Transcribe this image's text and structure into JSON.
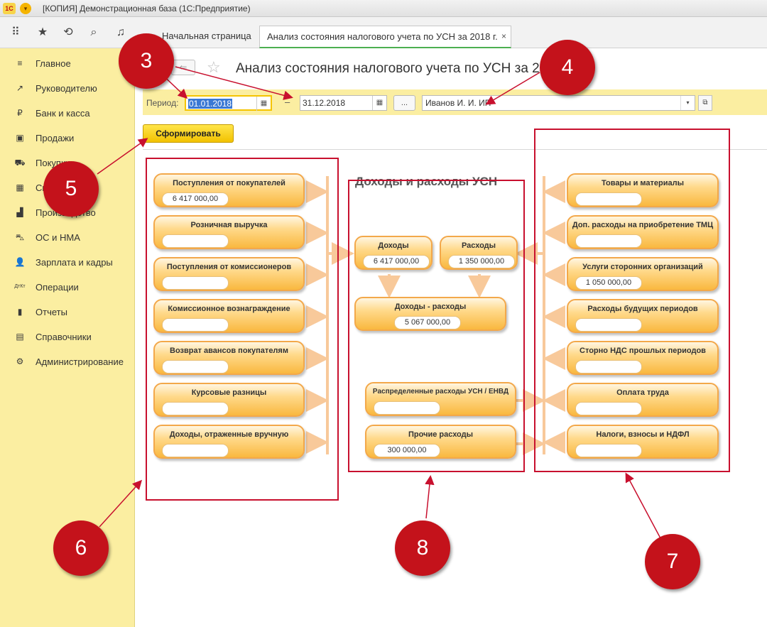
{
  "window": {
    "title": "[КОПИЯ] Демонстрационная база  (1С:Предприятие)",
    "logo": "1С",
    "menu_glyph": "▾"
  },
  "toolbar_icons": [
    {
      "name": "apps-grid-icon",
      "glyph": "⠿"
    },
    {
      "name": "star-icon",
      "glyph": "★"
    },
    {
      "name": "history-icon",
      "glyph": "⟲"
    },
    {
      "name": "search-icon",
      "glyph": "⌕"
    },
    {
      "name": "bell-icon",
      "glyph": "♫"
    }
  ],
  "sidebar": {
    "items": [
      {
        "icon": "≡",
        "label": "Главное"
      },
      {
        "icon": "↗",
        "label": "Руководителю"
      },
      {
        "icon": "₽",
        "label": "Банк и касса"
      },
      {
        "icon": "▣",
        "label": "Продажи"
      },
      {
        "icon": "⛟",
        "label": "Покупки"
      },
      {
        "icon": "▦",
        "label": "Склад"
      },
      {
        "icon": "▟",
        "label": "Производство"
      },
      {
        "icon": "⛍",
        "label": "ОС и НМА"
      },
      {
        "icon": "👤",
        "label": "Зарплата и кадры"
      },
      {
        "icon": "ДтКт",
        "label": "Операции"
      },
      {
        "icon": "▮",
        "label": "Отчеты"
      },
      {
        "icon": "▤",
        "label": "Справочники"
      },
      {
        "icon": "⚙",
        "label": "Администрирование"
      }
    ]
  },
  "tabs": {
    "home": "Начальная страница",
    "active": "Анализ состояния налогового учета по УСН за 2018 г.",
    "close": "×"
  },
  "form": {
    "back": "⇐",
    "star": "☆",
    "title": "Анализ состояния налогового учета по УСН за 2018 г.",
    "period_label": "Период:",
    "date_from": "01.01.2018",
    "dash": "–",
    "date_to": "31.12.2018",
    "cal_icon": "▦",
    "dots": "...",
    "organization": "Иванов И. И. ИП",
    "dropdown_icon": "▾",
    "open_icon": "⧉",
    "generate": "Сформировать"
  },
  "scheme": {
    "title": "Доходы и расходы УСН",
    "income_sources": [
      {
        "label": "Поступления от покупателей",
        "value": "6 417 000,00"
      },
      {
        "label": "Розничная выручка",
        "value": ""
      },
      {
        "label": "Поступления от комиссионеров",
        "value": ""
      },
      {
        "label": "Комиссионное вознаграждение",
        "value": ""
      },
      {
        "label": "Возврат авансов покупателям",
        "value": ""
      },
      {
        "label": "Курсовые разницы",
        "value": ""
      },
      {
        "label": "Доходы, отраженные вручную",
        "value": ""
      }
    ],
    "center": {
      "income": {
        "label": "Доходы",
        "value": "6 417 000,00"
      },
      "expenses": {
        "label": "Расходы",
        "value": "1 350 000,00"
      },
      "difference": {
        "label": "Доходы - расходы",
        "value": "5 067 000,00"
      },
      "distributed": {
        "label": "Распределенные расходы УСН / ЕНВД",
        "value": ""
      },
      "other": {
        "label": "Прочие расходы",
        "value": "300 000,00"
      }
    },
    "expense_sources": [
      {
        "label": "Товары и материалы",
        "value": ""
      },
      {
        "label": "Доп. расходы на приобретение ТМЦ",
        "value": ""
      },
      {
        "label": "Услуги сторонних организаций",
        "value": "1 050 000,00"
      },
      {
        "label": "Расходы будущих периодов",
        "value": ""
      },
      {
        "label": "Сторно НДС прошлых периодов",
        "value": ""
      },
      {
        "label": "Оплата труда",
        "value": ""
      },
      {
        "label": "Налоги, взносы и НДФЛ",
        "value": ""
      }
    ]
  },
  "callouts": [
    "3",
    "4",
    "5",
    "6",
    "7",
    "8"
  ],
  "colors": {
    "sidebar": "#fbeea1",
    "accent": "#f5c400",
    "callout": "#c4121b",
    "pill": "#f9b83f"
  }
}
